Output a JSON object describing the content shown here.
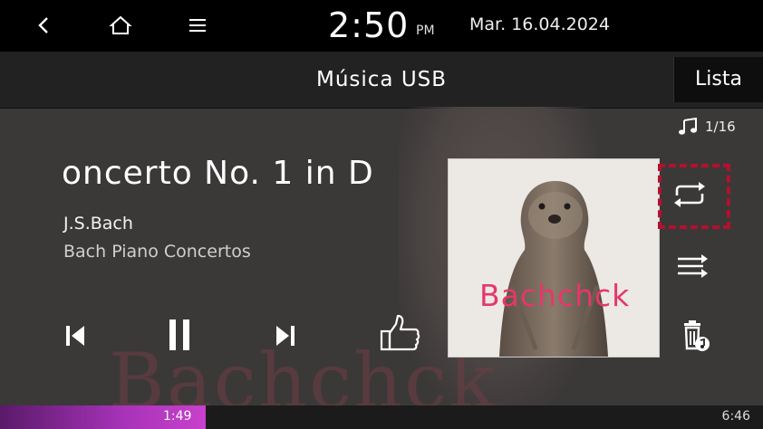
{
  "status": {
    "time": "2:50",
    "ampm": "PM",
    "date": "Mar. 16.04.2024"
  },
  "header": {
    "title": "Música USB",
    "list_button": "Lista"
  },
  "track": {
    "count": "1/16",
    "title": "oncerto No. 1 in D",
    "artist": "J.S.Bach",
    "album": "Bach Piano Concertos"
  },
  "cover": {
    "text": "Bachchck",
    "background_text": "Bachchck"
  },
  "playback": {
    "elapsed": "1:49",
    "duration": "6:46",
    "progress_fraction": 0.27
  },
  "icons": [
    "back-icon",
    "home-icon",
    "menu-icon",
    "music-note-icon",
    "previous-icon",
    "pause-icon",
    "next-icon",
    "thumbs-up-icon",
    "repeat-icon",
    "shuffle-icon",
    "delete-icon"
  ],
  "colors": {
    "progress": "#a733b8",
    "highlight": "#b3112c",
    "cover_text": "#e4386a"
  }
}
